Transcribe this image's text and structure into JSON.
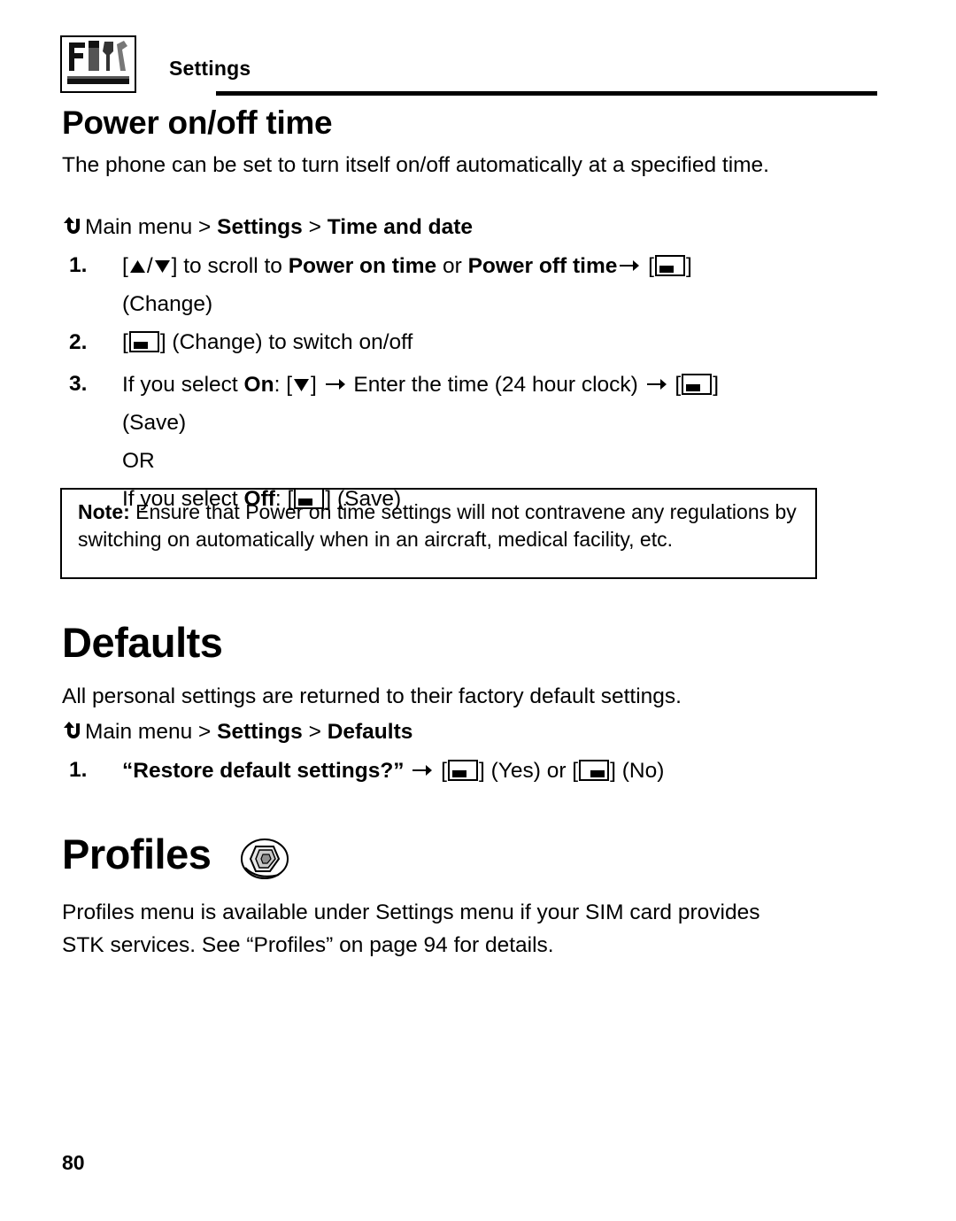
{
  "header": {
    "title": "Settings",
    "icon": "settings-tools-icon"
  },
  "sections": {
    "power": {
      "heading": "Power on/off time",
      "intro": "The phone can be set to turn itself on/off automatically at a specified time.",
      "nav": {
        "prefix": "Main menu > ",
        "b1": "Settings",
        "mid": " > ",
        "b2": "Time and date"
      },
      "steps": [
        {
          "num": "1.",
          "line1_a": "[",
          "line1_b": "] to scroll to ",
          "line1_bold1": "Power on time",
          "line1_c": " or ",
          "line1_bold2": "Power off time",
          "line1_d": " [",
          "line1_e": "]",
          "line2": "(Change)"
        },
        {
          "num": "2.",
          "line1_a": "[",
          "line1_b": "] (Change) to switch on/off"
        },
        {
          "num": "3.",
          "line1_a": "If you select ",
          "line1_bold": "On",
          "line1_b": ": [",
          "line1_c": "] ",
          "line1_d": " Enter the time (24 hour clock) ",
          "line1_e": " [",
          "line1_f": "]",
          "line2": "(Save)",
          "line3": "OR",
          "line4_a": "If you select ",
          "line4_bold": "Off",
          "line4_b": ": [",
          "line4_c": "] (Save)"
        }
      ],
      "note": {
        "label": "Note:",
        "text": " Ensure that Power on time settings will not contravene any regulations by switching on automatically when in an aircraft, medical facility, etc."
      }
    },
    "defaults": {
      "heading": "Defaults",
      "intro": "All personal settings are returned to their factory default settings.",
      "nav": {
        "prefix": "Main menu > ",
        "b1": "Settings",
        "mid": " > ",
        "b2": "Defaults"
      },
      "step": {
        "num": "1.",
        "bold": "“Restore default settings?”",
        "a": " ",
        "b": " [",
        "c": "] (Yes) or [",
        "d": "] (No)"
      }
    },
    "profiles": {
      "heading": "Profiles",
      "icon": "profiles-shield-icon",
      "body": "Profiles menu is available under Settings menu if your SIM card provides STK services. See “Profiles” on page 94 for details."
    }
  },
  "footer": {
    "page_number": "80"
  }
}
